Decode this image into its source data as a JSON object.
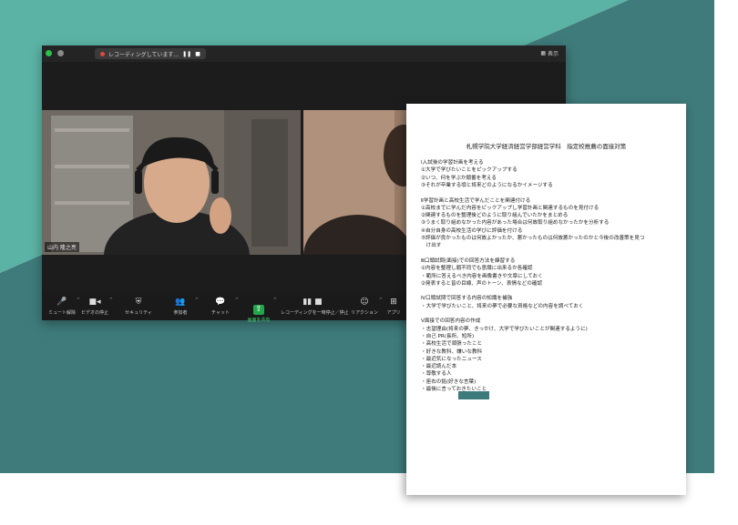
{
  "colors": {
    "teal_light": "#5bb3a5",
    "teal_dark": "#3f7b7b",
    "window_bg": "#1c1c1c",
    "share_green": "#22a64b",
    "redaction": "#3d7a7b"
  },
  "zoom": {
    "recording_label": "レコーディングしています...",
    "pause_icon": "pause-icon",
    "stop_icon": "stop-icon",
    "view_label": "表示",
    "participant_a_name": "山内 隆之亮",
    "toolbar": [
      {
        "label": "ミュート解除",
        "icon": "microphone-muted-icon",
        "glyph": "🎤"
      },
      {
        "label": "ビデオの停止",
        "icon": "video-camera-icon",
        "glyph": "▶"
      },
      {
        "label": "セキュリティ",
        "icon": "shield-icon",
        "glyph": "⛨"
      },
      {
        "label": "参加者",
        "icon": "participants-icon",
        "glyph": "👥"
      },
      {
        "label": "チャット",
        "icon": "chat-icon",
        "glyph": "💬"
      },
      {
        "label": "画面を共有",
        "icon": "share-screen-icon",
        "glyph": "⇧"
      },
      {
        "label": "レコーディングを一時停止／停止",
        "icon": "recording-controls-icon",
        "glyph": "▮▮ ■"
      },
      {
        "label": "リアクション",
        "icon": "reaction-icon",
        "glyph": "☺"
      },
      {
        "label": "アプリ",
        "icon": "apps-icon",
        "glyph": "⊞"
      }
    ]
  },
  "document": {
    "title": "札幌学院大学経済経営学部経営学科　指定校推薦の面接対策",
    "lines": [
      "Ⅰ入試後の学習計画を考える",
      "①大学で学びたいことをピックアップする",
      "②いつ、何を学ぶか順番を考える",
      "③それが卒業する頃と将来どのようになるかイメージする",
      "",
      "Ⅱ学習計画と高校生活で学んだことを関連付ける",
      "①高校までに学んだ内容をピックアップし学習計画と関連するものを見付ける",
      "②関連するものを整理後どのように取り組んでいたかをまとめる",
      "③うまく取り組めなかった内容があった場合は何故取り組めなかったかを分析する",
      "④自分自身の高校生活の学びに評価を付ける",
      "⑤評価が良かったものは何故よかったか、悪かったものは何故悪かったのかと今後の改善策を見つ",
      "　け出す",
      "",
      "Ⅲ口頭試問(面接)での回答方法を練習する",
      "①内容を整理し順不同でも意識に出来るか各確認",
      "・範所に答えるべき内容を画像書きや文章にしておく",
      "②発表すると皆の目線、声のトーン、表情などの確認",
      "",
      "Ⅳ口頭試問で回答する内容の知識を補強",
      "・大学で学びたいこと、将来の夢で必要な資格などの内容を調べておく",
      "",
      "Ⅴ面接での回答内容の作成",
      "・志望理由(将来の夢、きっかけ、大学で学びたいことが関連するように)",
      "・自己 PR(長所、短所)",
      "・高校生活で頑張ったこと",
      "・好きな教科、嫌いな教科",
      "・最近気になったニュース",
      "・最近読んだ本",
      "・尊敬する人",
      "・座右の銘(好きな言葉)",
      "・最後に言っておきたいこと"
    ]
  }
}
